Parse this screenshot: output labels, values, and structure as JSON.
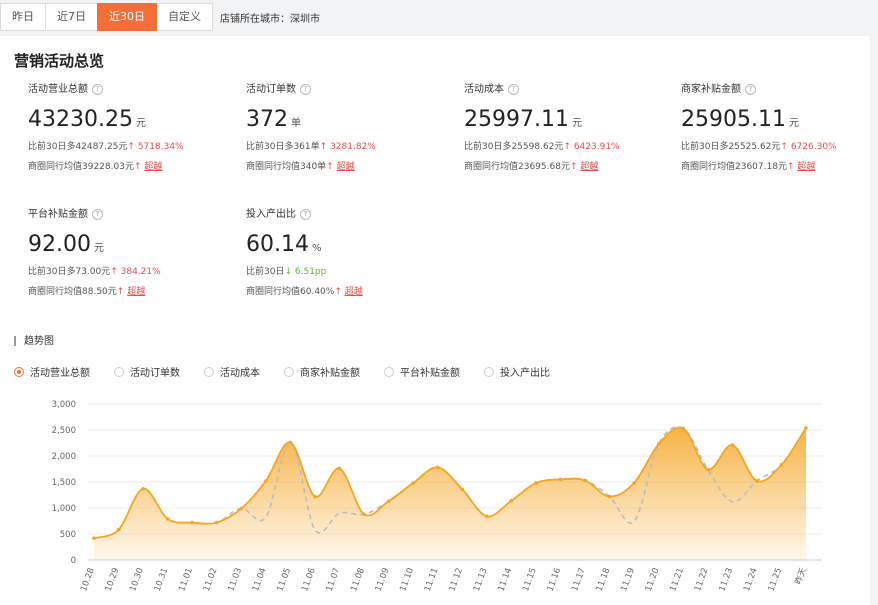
{
  "tabs": [
    {
      "label": "昨日",
      "active": false
    },
    {
      "label": "近7日",
      "active": false
    },
    {
      "label": "近30日",
      "active": true
    },
    {
      "label": "自定义",
      "active": false
    }
  ],
  "store_city": "店铺所在城市：深圳市",
  "section_title": "营销活动总览",
  "metrics": [
    {
      "label": "活动营业总额",
      "value": "43230.25",
      "unit": "元",
      "compare": "比前30日多42487.25元",
      "compare_arrow": "↑",
      "compare_change": "5718.34%",
      "compare_dir": "up",
      "peer": "商圈同行均值39228.03元",
      "peer_arrow": "↑",
      "peer_tag": "超越"
    },
    {
      "label": "活动订单数",
      "value": "372",
      "unit": "单",
      "compare": "比前30日多361单",
      "compare_arrow": "↑",
      "compare_change": "3281.82%",
      "compare_dir": "up",
      "peer": "商圈同行均值340单",
      "peer_arrow": "↑",
      "peer_tag": "超越"
    },
    {
      "label": "活动成本",
      "value": "25997.11",
      "unit": "元",
      "compare": "比前30日多25598.62元",
      "compare_arrow": "↑",
      "compare_change": "6423.91%",
      "compare_dir": "up",
      "peer": "商圈同行均值23695.68元",
      "peer_arrow": "↑",
      "peer_tag": "超越"
    },
    {
      "label": "商家补贴金额",
      "value": "25905.11",
      "unit": "元",
      "compare": "比前30日多25525.62元",
      "compare_arrow": "↑",
      "compare_change": "6726.30%",
      "compare_dir": "up",
      "peer": "商圈同行均值23607.18元",
      "peer_arrow": "↑",
      "peer_tag": "超越"
    },
    {
      "label": "平台补贴金额",
      "value": "92.00",
      "unit": "元",
      "compare": "比前30日多73.00元",
      "compare_arrow": "↑",
      "compare_change": "384.21%",
      "compare_dir": "up",
      "peer": "商圈同行均值88.50元",
      "peer_arrow": "↑",
      "peer_tag": "超越"
    },
    {
      "label": "投入产出比",
      "value": "60.14",
      "unit": "%",
      "compare": "比前30日",
      "compare_arrow": "↓",
      "compare_change": "6.51pp",
      "compare_dir": "down",
      "peer": "商圈同行均值60.40%",
      "peer_arrow": "↑",
      "peer_tag": "超越"
    }
  ],
  "trend_title": "趋势图",
  "legend": [
    {
      "label": "活动营业总额",
      "selected": true
    },
    {
      "label": "活动订单数",
      "selected": false
    },
    {
      "label": "活动成本",
      "selected": false
    },
    {
      "label": "商家补贴金额",
      "selected": false
    },
    {
      "label": "平台补贴金额",
      "selected": false
    },
    {
      "label": "投入产出比",
      "selected": false
    }
  ],
  "colors": {
    "accent": "#f46e3a",
    "series": "#f5a623",
    "compare_line": "#b8bcc8",
    "up": "#ef4b4b",
    "down": "#52c41a"
  },
  "chart_data": {
    "type": "area",
    "categories": [
      "10.28",
      "10.29",
      "10.30",
      "10.31",
      "11.01",
      "11.02",
      "11.03",
      "11.04",
      "11.05",
      "11.06",
      "11.07",
      "11.08",
      "11.09",
      "11.10",
      "11.11",
      "11.12",
      "11.13",
      "11.14",
      "11.15",
      "11.16",
      "11.17",
      "11.18",
      "11.19",
      "11.20",
      "11.21",
      "11.22",
      "11.23",
      "11.24",
      "11.25",
      "昨天"
    ],
    "series": [
      {
        "values": [
          420,
          580,
          1370,
          790,
          720,
          720,
          990,
          1520,
          2260,
          1220,
          1760,
          880,
          1130,
          1480,
          1780,
          1360,
          840,
          1140,
          1480,
          1550,
          1530,
          1220,
          1480,
          2230,
          2530,
          1740,
          2210,
          1520,
          1830,
          2540
        ]
      },
      {
        "values": [
          420,
          580,
          1370,
          790,
          720,
          720,
          990,
          820,
          2260,
          580,
          900,
          880,
          1130,
          1480,
          1780,
          1360,
          840,
          1140,
          1480,
          1550,
          1530,
          1220,
          740,
          2230,
          2530,
          1740,
          1120,
          1520,
          1830,
          2540
        ]
      }
    ],
    "yticks": [
      0,
      500,
      1000,
      1500,
      2000,
      2500,
      3000
    ],
    "ylim": [
      0,
      3000
    ]
  }
}
